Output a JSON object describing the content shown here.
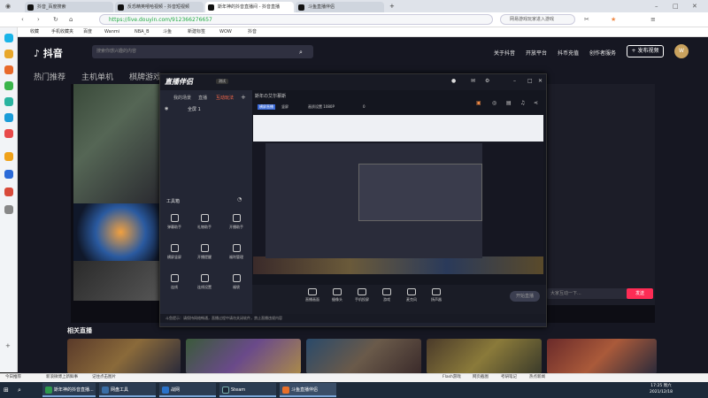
{
  "browser": {
    "tabs": [
      {
        "label": "抖音_百度搜索",
        "active": false
      },
      {
        "label": "反恐精英嘻哈视频 - 抖音短视频",
        "active": false
      },
      {
        "label": "斯年神的抖音直播间 - 抖音直播",
        "active": true
      },
      {
        "label": "斗鱼直播伴侣",
        "active": false
      }
    ],
    "url": "https://live.douyin.com/912366276657",
    "search_placeholder": "网易游戏玩家进入游戏",
    "bookmarks": [
      "收藏",
      "手机收藏夹",
      "百度",
      "Wanmi",
      "NBA_B",
      "斗鱼",
      "新建标签",
      "WOW",
      "抖音"
    ]
  },
  "douyin": {
    "logo": "抖音",
    "search_placeholder": "搜索你感兴趣的内容",
    "header_links": [
      "关于抖音",
      "开放平台",
      "抖币充值",
      "创作者服务"
    ],
    "publish_label": "+ 发布视频",
    "avatar_text": "W",
    "nav_tabs": [
      "热门推荐",
      "主机单机",
      "棋牌游戏"
    ],
    "chat_placeholder": "大家互动一下...",
    "send_label": "发送",
    "related_title": "相关直播"
  },
  "app": {
    "logo": "直播伴侣",
    "version": "测试",
    "left_tabs": [
      "我的场景",
      "直播",
      "互动玩法"
    ],
    "scene_label": "全屏 1",
    "tools_title": "工具箱",
    "tools": [
      "弹幕助手",
      "礼物助手",
      "开播助手",
      "横屏竖屏",
      "开播提醒",
      "福利管理",
      "连线",
      "连线设置",
      "福袋"
    ],
    "preview_title": "斯年の艾尔慕斯",
    "preview_meta": [
      "横屏直播",
      "竖屏",
      "画质设置 1080P",
      "0"
    ],
    "controls": [
      "直播画面",
      "摄像头",
      "手机投屏",
      "游戏",
      "麦克风",
      "扬声器"
    ],
    "start_label": "开始直播",
    "status_text": "斗鱼提示：请保持网络畅通，直播过程中请勿关闭软件，禁止直播违规内容"
  },
  "statusbar": [
    "今日推荐",
    "新浪微博上新鲜事",
    "记住点击图片",
    "Flash游戏",
    "网页截图",
    "考研笔记",
    "热点新闻"
  ],
  "taskbar": {
    "items": [
      {
        "label": "斯年神的抖音直播...",
        "color": "#2f9a4e"
      },
      {
        "label": "网盘工具",
        "color": "#3a6ea5"
      },
      {
        "label": "战网",
        "color": "#2a72c9"
      },
      {
        "label": "Steam",
        "color": "#1b2838"
      },
      {
        "label": "斗鱼直播伴侣",
        "color": "#e8702a"
      }
    ],
    "time": "17:25 周六",
    "date": "2021/12/18"
  }
}
